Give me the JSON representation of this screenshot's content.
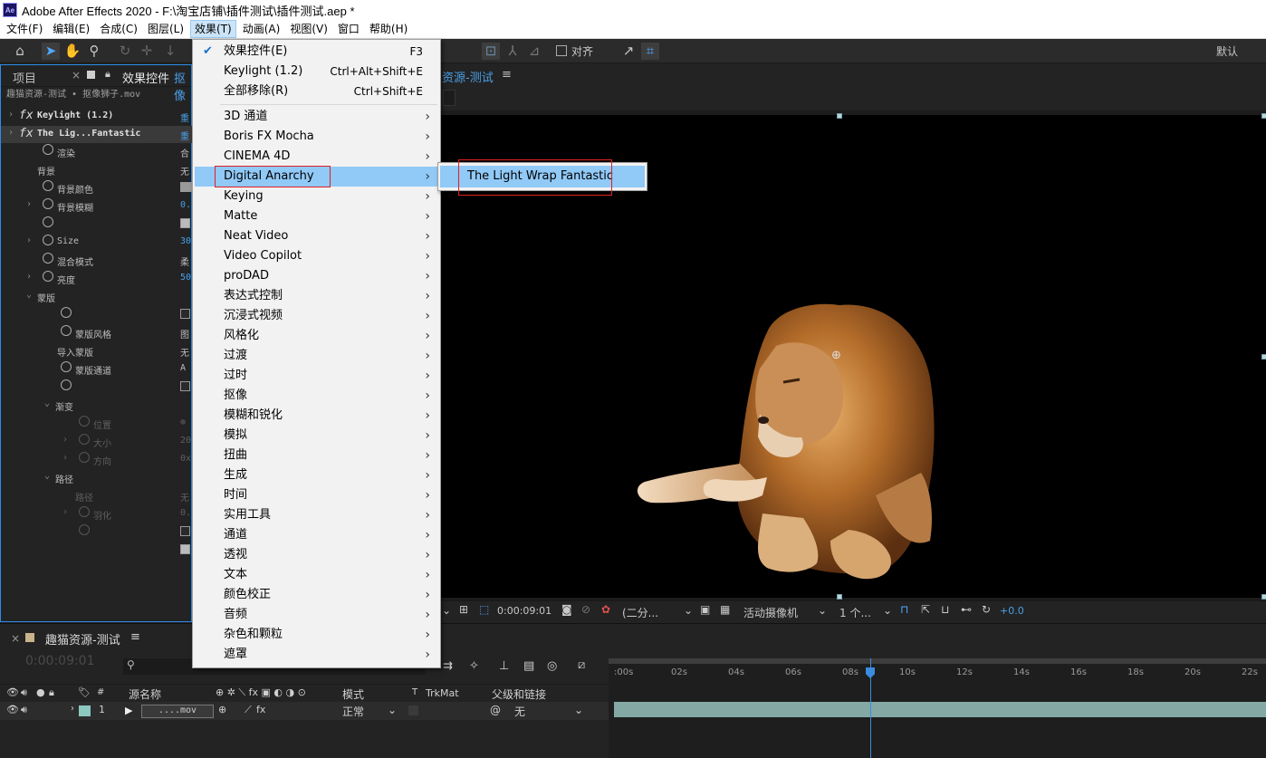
{
  "window": {
    "title": "Adobe After Effects 2020 - F:\\淘宝店铺\\插件测试\\插件测试.aep *",
    "logo": "Ae"
  },
  "menubar": [
    "文件(F)",
    "编辑(E)",
    "合成(C)",
    "图层(L)",
    "效果(T)",
    "动画(A)",
    "视图(V)",
    "窗口",
    "帮助(H)"
  ],
  "toolbar": {
    "snap_label": "对齐",
    "workspace": "默认"
  },
  "left_panel": {
    "tab_project": "项目",
    "tab_effects": "效果控件",
    "tab_effects_suffix": "抠像",
    "subtitle": "趣猫资源-测试 • 抠像狮子.mov",
    "rows": [
      {
        "label": "Keylight (1.2)",
        "value": "重"
      },
      {
        "label": "The Lig...Fantastic",
        "value": "重"
      },
      {
        "label": "渲染",
        "value": "合"
      },
      {
        "label": "背景",
        "value": "无"
      },
      {
        "label": "背景颜色",
        "value": ""
      },
      {
        "label": "背景模糊",
        "value": "0."
      },
      {
        "label": "",
        "value": ""
      },
      {
        "label": "Size",
        "value": "30"
      },
      {
        "label": "混合模式",
        "value": "柔"
      },
      {
        "label": "亮度",
        "value": "50"
      },
      {
        "label": "蒙版",
        "value": ""
      },
      {
        "label": "",
        "value": ""
      },
      {
        "label": "蒙版风格",
        "value": "图"
      },
      {
        "label": "导入蒙版",
        "value": "无"
      },
      {
        "label": "蒙版通道",
        "value": "A"
      },
      {
        "label": "",
        "value": ""
      },
      {
        "label": "渐变",
        "value": ""
      },
      {
        "label": "位置",
        "value": "⊕"
      },
      {
        "label": "大小",
        "value": "20"
      },
      {
        "label": "方向",
        "value": "0x"
      },
      {
        "label": "路径",
        "value": ""
      },
      {
        "label": "路径",
        "value": "无"
      },
      {
        "label": "羽化",
        "value": "0."
      },
      {
        "label": "",
        "value": ""
      },
      {
        "label": "",
        "value": ""
      }
    ]
  },
  "effects_menu": {
    "top_items": [
      {
        "label": "效果控件(E)",
        "shortcut": "F3",
        "checked": true
      },
      {
        "label": "Keylight (1.2)",
        "shortcut": "Ctrl+Alt+Shift+E"
      },
      {
        "label": "全部移除(R)",
        "shortcut": "Ctrl+Shift+E"
      }
    ],
    "categories": [
      "3D 通道",
      "Boris FX Mocha",
      "CINEMA 4D",
      "Digital Anarchy",
      "Keying",
      "Matte",
      "Neat Video",
      "Video Copilot",
      "proDAD",
      "表达式控制",
      "沉浸式视频",
      "风格化",
      "过渡",
      "过时",
      "抠像",
      "模糊和锐化",
      "模拟",
      "扭曲",
      "生成",
      "时间",
      "实用工具",
      "通道",
      "透视",
      "文本",
      "颜色校正",
      "音频",
      "杂色和颗粒",
      "遮罩"
    ],
    "highlighted": "Digital Anarchy",
    "submenu_item": "The Light Wrap Fantastic"
  },
  "composition": {
    "tab_label": "资源-测试",
    "timecode": "0:00:09:01",
    "resolution": "(二分...",
    "camera": "活动摄像机",
    "views": "1 个...",
    "exposure": "+0.0"
  },
  "timeline": {
    "comp_name": "趣猫资源-测试",
    "timecode": "0:00:09:01",
    "columns": {
      "source": "源名称",
      "mode": "模式",
      "trkmat": "TrkMat",
      "parent": "父级和链接"
    },
    "layer": {
      "index": "1",
      "name": "....mov",
      "mode": "正常",
      "parent": "无"
    },
    "ruler": ":00s|02s|04s|06s|08s|10s|12s|14s|16s|18s|20s|22s"
  }
}
